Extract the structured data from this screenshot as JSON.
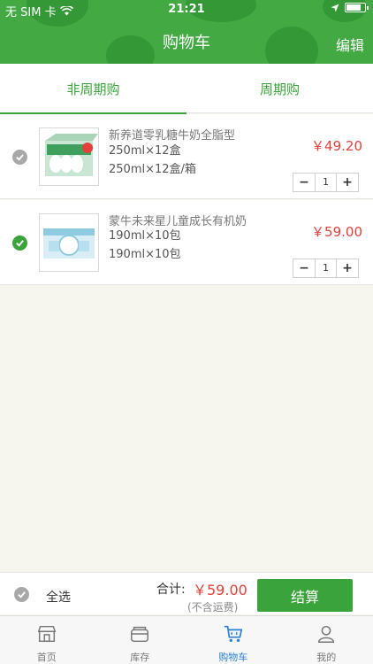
{
  "status_bar": {
    "carrier": "无 SIM 卡",
    "time": "21:21"
  },
  "nav": {
    "title": "购物车",
    "edit_label": "编辑"
  },
  "tabs": [
    {
      "label": "非周期购",
      "active": true
    },
    {
      "label": "周期购",
      "active": false
    }
  ],
  "items": [
    {
      "name": "新养道零乳糖牛奶全脂型",
      "spec": "250ml×12盒",
      "unit": "250ml×12盒/箱",
      "price": "￥49.20",
      "qty": "1",
      "selected": false,
      "image_icon": "milk-box-icon"
    },
    {
      "name": "蒙牛未来星儿童成长有机奶",
      "spec": "190ml×10包",
      "unit": "190ml×10包",
      "price": "￥59.00",
      "qty": "1",
      "selected": true,
      "image_icon": "milk-pack-icon"
    }
  ],
  "checkout": {
    "select_all_label": "全选",
    "total_label": "合计:",
    "total_price": "￥59.00",
    "shipping_note": "(不含运费)",
    "pay_label": "结算"
  },
  "tabbar": [
    {
      "label": "首页",
      "icon": "store-icon",
      "active": false
    },
    {
      "label": "库存",
      "icon": "inventory-icon",
      "active": false
    },
    {
      "label": "购物车",
      "icon": "cart-icon",
      "active": true
    },
    {
      "label": "我的",
      "icon": "user-icon",
      "active": false
    }
  ],
  "colors": {
    "brand_green": "#43a942",
    "price_red": "#e2403a",
    "tab_active_blue": "#2a7fd6"
  }
}
